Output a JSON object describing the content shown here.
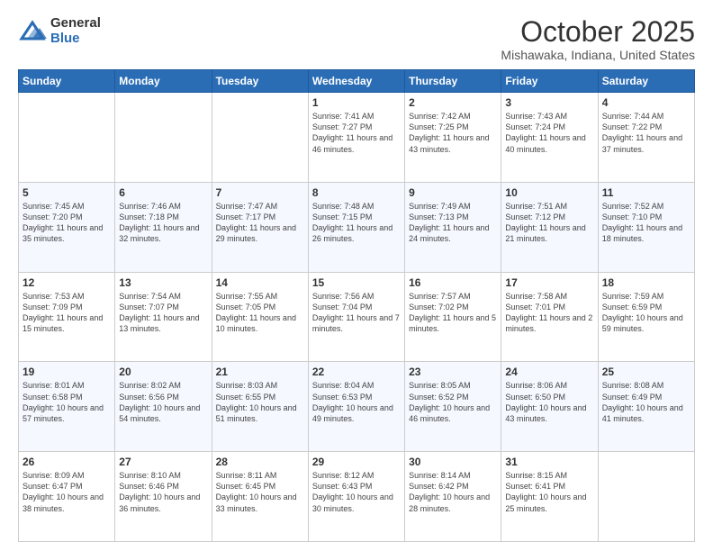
{
  "header": {
    "logo_general": "General",
    "logo_blue": "Blue",
    "month": "October 2025",
    "location": "Mishawaka, Indiana, United States"
  },
  "weekdays": [
    "Sunday",
    "Monday",
    "Tuesday",
    "Wednesday",
    "Thursday",
    "Friday",
    "Saturday"
  ],
  "weeks": [
    [
      {
        "day": "",
        "info": ""
      },
      {
        "day": "",
        "info": ""
      },
      {
        "day": "",
        "info": ""
      },
      {
        "day": "1",
        "info": "Sunrise: 7:41 AM\nSunset: 7:27 PM\nDaylight: 11 hours and 46 minutes."
      },
      {
        "day": "2",
        "info": "Sunrise: 7:42 AM\nSunset: 7:25 PM\nDaylight: 11 hours and 43 minutes."
      },
      {
        "day": "3",
        "info": "Sunrise: 7:43 AM\nSunset: 7:24 PM\nDaylight: 11 hours and 40 minutes."
      },
      {
        "day": "4",
        "info": "Sunrise: 7:44 AM\nSunset: 7:22 PM\nDaylight: 11 hours and 37 minutes."
      }
    ],
    [
      {
        "day": "5",
        "info": "Sunrise: 7:45 AM\nSunset: 7:20 PM\nDaylight: 11 hours and 35 minutes."
      },
      {
        "day": "6",
        "info": "Sunrise: 7:46 AM\nSunset: 7:18 PM\nDaylight: 11 hours and 32 minutes."
      },
      {
        "day": "7",
        "info": "Sunrise: 7:47 AM\nSunset: 7:17 PM\nDaylight: 11 hours and 29 minutes."
      },
      {
        "day": "8",
        "info": "Sunrise: 7:48 AM\nSunset: 7:15 PM\nDaylight: 11 hours and 26 minutes."
      },
      {
        "day": "9",
        "info": "Sunrise: 7:49 AM\nSunset: 7:13 PM\nDaylight: 11 hours and 24 minutes."
      },
      {
        "day": "10",
        "info": "Sunrise: 7:51 AM\nSunset: 7:12 PM\nDaylight: 11 hours and 21 minutes."
      },
      {
        "day": "11",
        "info": "Sunrise: 7:52 AM\nSunset: 7:10 PM\nDaylight: 11 hours and 18 minutes."
      }
    ],
    [
      {
        "day": "12",
        "info": "Sunrise: 7:53 AM\nSunset: 7:09 PM\nDaylight: 11 hours and 15 minutes."
      },
      {
        "day": "13",
        "info": "Sunrise: 7:54 AM\nSunset: 7:07 PM\nDaylight: 11 hours and 13 minutes."
      },
      {
        "day": "14",
        "info": "Sunrise: 7:55 AM\nSunset: 7:05 PM\nDaylight: 11 hours and 10 minutes."
      },
      {
        "day": "15",
        "info": "Sunrise: 7:56 AM\nSunset: 7:04 PM\nDaylight: 11 hours and 7 minutes."
      },
      {
        "day": "16",
        "info": "Sunrise: 7:57 AM\nSunset: 7:02 PM\nDaylight: 11 hours and 5 minutes."
      },
      {
        "day": "17",
        "info": "Sunrise: 7:58 AM\nSunset: 7:01 PM\nDaylight: 11 hours and 2 minutes."
      },
      {
        "day": "18",
        "info": "Sunrise: 7:59 AM\nSunset: 6:59 PM\nDaylight: 10 hours and 59 minutes."
      }
    ],
    [
      {
        "day": "19",
        "info": "Sunrise: 8:01 AM\nSunset: 6:58 PM\nDaylight: 10 hours and 57 minutes."
      },
      {
        "day": "20",
        "info": "Sunrise: 8:02 AM\nSunset: 6:56 PM\nDaylight: 10 hours and 54 minutes."
      },
      {
        "day": "21",
        "info": "Sunrise: 8:03 AM\nSunset: 6:55 PM\nDaylight: 10 hours and 51 minutes."
      },
      {
        "day": "22",
        "info": "Sunrise: 8:04 AM\nSunset: 6:53 PM\nDaylight: 10 hours and 49 minutes."
      },
      {
        "day": "23",
        "info": "Sunrise: 8:05 AM\nSunset: 6:52 PM\nDaylight: 10 hours and 46 minutes."
      },
      {
        "day": "24",
        "info": "Sunrise: 8:06 AM\nSunset: 6:50 PM\nDaylight: 10 hours and 43 minutes."
      },
      {
        "day": "25",
        "info": "Sunrise: 8:08 AM\nSunset: 6:49 PM\nDaylight: 10 hours and 41 minutes."
      }
    ],
    [
      {
        "day": "26",
        "info": "Sunrise: 8:09 AM\nSunset: 6:47 PM\nDaylight: 10 hours and 38 minutes."
      },
      {
        "day": "27",
        "info": "Sunrise: 8:10 AM\nSunset: 6:46 PM\nDaylight: 10 hours and 36 minutes."
      },
      {
        "day": "28",
        "info": "Sunrise: 8:11 AM\nSunset: 6:45 PM\nDaylight: 10 hours and 33 minutes."
      },
      {
        "day": "29",
        "info": "Sunrise: 8:12 AM\nSunset: 6:43 PM\nDaylight: 10 hours and 30 minutes."
      },
      {
        "day": "30",
        "info": "Sunrise: 8:14 AM\nSunset: 6:42 PM\nDaylight: 10 hours and 28 minutes."
      },
      {
        "day": "31",
        "info": "Sunrise: 8:15 AM\nSunset: 6:41 PM\nDaylight: 10 hours and 25 minutes."
      },
      {
        "day": "",
        "info": ""
      }
    ]
  ]
}
